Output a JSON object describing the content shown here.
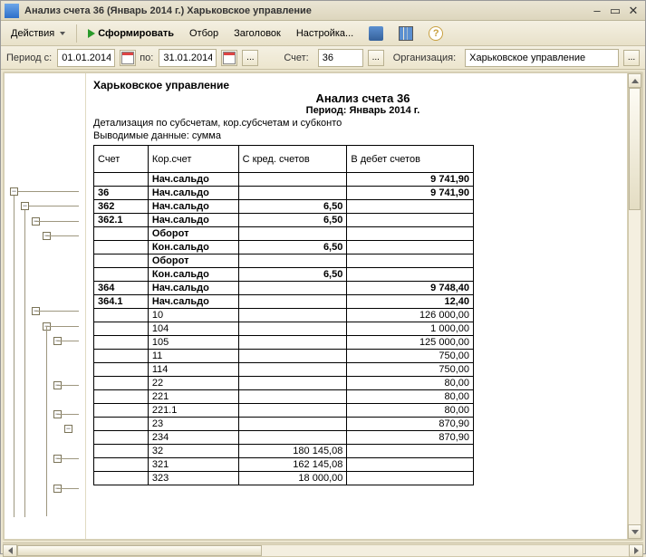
{
  "window": {
    "title": "Анализ счета 36 (Январь 2014 г.) Харьковское управление"
  },
  "toolbar": {
    "actions": "Действия",
    "run": "Сформировать",
    "filter": "Отбор",
    "header": "Заголовок",
    "settings": "Настройка...",
    "help_glyph": "?"
  },
  "params": {
    "period_from_label": "Период с:",
    "period_from": "01.01.2014",
    "period_to_label": "по:",
    "period_to": "31.01.2014",
    "account_label": "Счет:",
    "account": "36",
    "org_label": "Организация:",
    "org": "Харьковское управление"
  },
  "report": {
    "org": "Харьковское управление",
    "title": "Анализ счета 36",
    "period": "Период: Январь 2014 г.",
    "detail": "Детализация по  субсчетам, кор.субсчетам и субконто",
    "output": "Выводимые данные: сумма",
    "cols": {
      "c1": "Счет",
      "c2": "Кор.счет",
      "c3": "С кред. счетов",
      "c4": "В дебет счетов"
    },
    "rows": [
      {
        "c1": "",
        "c2": "Нач.сальдо",
        "c3": "",
        "c4": "9 741,90",
        "bold": true
      },
      {
        "c1": "36",
        "c2": "Нач.сальдо",
        "c3": "",
        "c4": "9 741,90",
        "bold": true
      },
      {
        "c1": "362",
        "c2": "Нач.сальдо",
        "c3": "6,50",
        "c4": "",
        "bold": true
      },
      {
        "c1": "362.1",
        "c2": "Нач.сальдо",
        "c3": "6,50",
        "c4": "",
        "bold": true
      },
      {
        "c1": "",
        "c2": "Оборот",
        "c3": "",
        "c4": "",
        "bold": true
      },
      {
        "c1": "",
        "c2": "Кон.сальдо",
        "c3": "6,50",
        "c4": "",
        "bold": true
      },
      {
        "c1": "",
        "c2": "Оборот",
        "c3": "",
        "c4": "",
        "bold": true
      },
      {
        "c1": "",
        "c2": "Кон.сальдо",
        "c3": "6,50",
        "c4": "",
        "bold": true
      },
      {
        "c1": "364",
        "c2": "Нач.сальдо",
        "c3": "",
        "c4": "9 748,40",
        "bold": true
      },
      {
        "c1": "364.1",
        "c2": "Нач.сальдо",
        "c3": "",
        "c4": "12,40",
        "bold": true
      },
      {
        "c1": "",
        "c2": "10",
        "c3": "",
        "c4": "126 000,00",
        "bold": false
      },
      {
        "c1": "",
        "c2": "104",
        "c3": "",
        "c4": "1 000,00",
        "bold": false
      },
      {
        "c1": "",
        "c2": "105",
        "c3": "",
        "c4": "125 000,00",
        "bold": false
      },
      {
        "c1": "",
        "c2": "11",
        "c3": "",
        "c4": "750,00",
        "bold": false
      },
      {
        "c1": "",
        "c2": "114",
        "c3": "",
        "c4": "750,00",
        "bold": false
      },
      {
        "c1": "",
        "c2": "22",
        "c3": "",
        "c4": "80,00",
        "bold": false
      },
      {
        "c1": "",
        "c2": "221",
        "c3": "",
        "c4": "80,00",
        "bold": false
      },
      {
        "c1": "",
        "c2": "221.1",
        "c3": "",
        "c4": "80,00",
        "bold": false
      },
      {
        "c1": "",
        "c2": "23",
        "c3": "",
        "c4": "870,90",
        "bold": false
      },
      {
        "c1": "",
        "c2": "234",
        "c3": "",
        "c4": "870,90",
        "bold": false
      },
      {
        "c1": "",
        "c2": "32",
        "c3": "180 145,08",
        "c4": "",
        "bold": false
      },
      {
        "c1": "",
        "c2": "321",
        "c3": "162 145,08",
        "c4": "",
        "bold": false
      },
      {
        "c1": "",
        "c2": "323",
        "c3": "18 000,00",
        "c4": "",
        "bold": false
      }
    ]
  },
  "ellipsis": "...",
  "outline_minus": "−"
}
